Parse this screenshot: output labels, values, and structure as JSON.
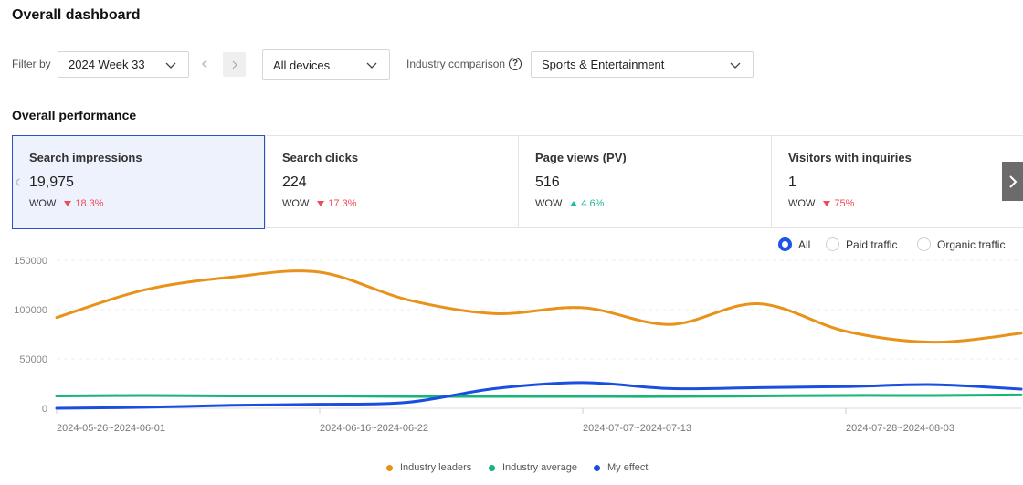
{
  "page": {
    "title": "Overall dashboard"
  },
  "filters": {
    "label": "Filter by",
    "week": "2024 Week 33",
    "device": "All devices",
    "industry_label": "Industry comparison",
    "help_icon": "?",
    "industry": "Sports & Entertainment"
  },
  "section": {
    "title": "Overall performance"
  },
  "metrics": [
    {
      "name": "Search impressions",
      "value": "19,975",
      "wow_label": "WOW",
      "change": "18.3%",
      "direction": "down"
    },
    {
      "name": "Search clicks",
      "value": "224",
      "wow_label": "WOW",
      "change": "17.3%",
      "direction": "down"
    },
    {
      "name": "Page views (PV)",
      "value": "516",
      "wow_label": "WOW",
      "change": "4.6%",
      "direction": "up"
    },
    {
      "name": "Visitors with inquiries",
      "value": "1",
      "wow_label": "WOW",
      "change": "75%",
      "direction": "down"
    }
  ],
  "traffic_filter": {
    "options": [
      "All",
      "Paid traffic",
      "Organic traffic"
    ],
    "selected": "All"
  },
  "colors": {
    "accent": "#1a54e8",
    "down": "#f04a5a",
    "up": "#21b8a0"
  },
  "chart_data": {
    "type": "line",
    "title": "",
    "xlabel": "",
    "ylabel": "",
    "ylim": [
      0,
      150000
    ],
    "yticks": [
      0,
      50000,
      100000,
      150000
    ],
    "grid": true,
    "legend_position": "bottom",
    "x_tick_labels": [
      "2024-05-26~2024-06-01",
      "2024-06-16~2024-06-22",
      "2024-07-07~2024-07-13",
      "2024-07-28~2024-08-03"
    ],
    "x_tick_index": [
      0,
      3,
      6,
      9
    ],
    "series": [
      {
        "name": "Industry leaders",
        "color": "#e8921a",
        "values": [
          92000,
          120000,
          133000,
          138000,
          110000,
          96000,
          102000,
          85000,
          106000,
          78000,
          67000,
          76000
        ]
      },
      {
        "name": "Industry average",
        "color": "#17b57a",
        "values": [
          12500,
          13000,
          12500,
          12500,
          12000,
          12000,
          12000,
          12000,
          12500,
          13000,
          13000,
          13500
        ]
      },
      {
        "name": "My effect",
        "color": "#1a4ee0",
        "values": [
          0,
          1000,
          3000,
          4000,
          6000,
          20000,
          26000,
          20000,
          21000,
          22000,
          24000,
          19500
        ]
      }
    ]
  }
}
